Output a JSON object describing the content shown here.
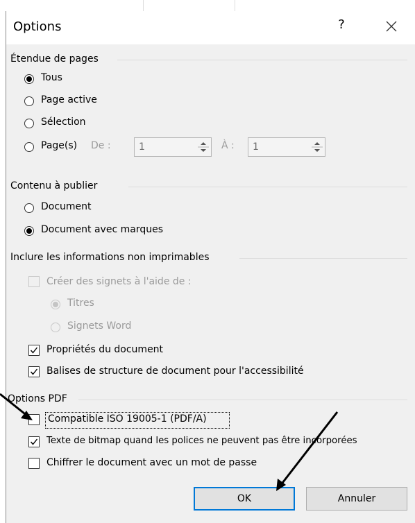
{
  "dialog": {
    "title": "Options",
    "help_label": "?",
    "close_icon": "close-icon"
  },
  "page_range": {
    "group_label": "Étendue de pages",
    "options": [
      {
        "label": "Tous",
        "checked": true
      },
      {
        "label": "Page active",
        "checked": false
      },
      {
        "label": "Sélection",
        "checked": false
      },
      {
        "label": "Page(s)",
        "checked": false
      }
    ],
    "from_label": "De :",
    "from_value": "1",
    "to_label": "À :",
    "to_value": "1"
  },
  "content": {
    "group_label": "Contenu à publier",
    "options": [
      {
        "label": "Document",
        "checked": false
      },
      {
        "label": "Document avec marques",
        "checked": true
      }
    ]
  },
  "non_printable": {
    "group_label": "Inclure les informations non imprimables",
    "bookmarks_label": "Créer des signets à l'aide de :",
    "bookmarks_checked": false,
    "bookmark_sources": [
      {
        "label": "Titres",
        "checked": true
      },
      {
        "label": "Signets Word",
        "checked": false
      }
    ],
    "doc_properties_label": "Propriétés du document",
    "doc_properties_checked": true,
    "structure_tags_label": "Balises de structure de document pour l'accessibilité",
    "structure_tags_checked": true
  },
  "pdf_options": {
    "group_label": "Options PDF",
    "iso_label": "Compatible ISO 19005-1 (PDF/A)",
    "iso_checked": false,
    "bitmap_label": "Texte de bitmap quand les polices ne peuvent pas être incorporées",
    "bitmap_checked": true,
    "encrypt_label": "Chiffrer le document avec un mot de passe",
    "encrypt_checked": false
  },
  "buttons": {
    "ok_label": "OK",
    "cancel_label": "Annuler"
  },
  "colors": {
    "dialog_bg": "#f0f0f0",
    "accent": "#0078d7",
    "disabled_text": "#9a9a9a"
  }
}
